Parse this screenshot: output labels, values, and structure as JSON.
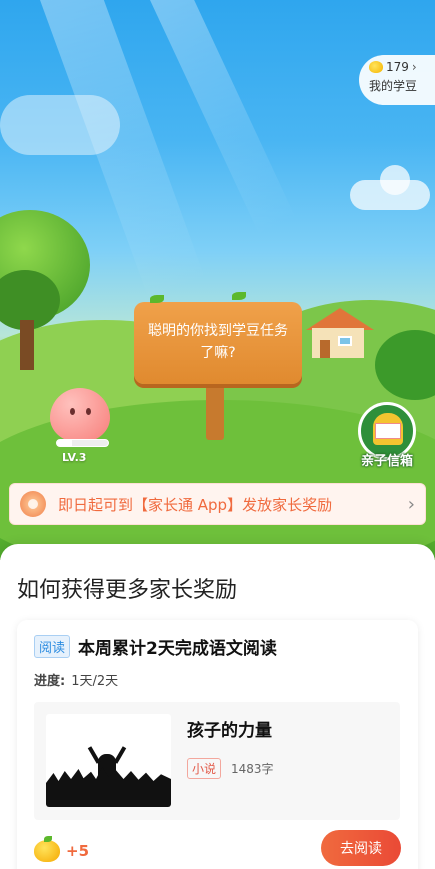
{
  "colors": {
    "accent": "#f06a3e",
    "sky": "#49b5f3",
    "grass": "#6cc23c",
    "read_tag": "#2c8ce0"
  },
  "coins": {
    "count": "179",
    "label": "我的学豆",
    "icon": "bean-coin-icon"
  },
  "sign": {
    "text": "聪明的你找到学豆任务了嘛?"
  },
  "pet": {
    "level_label": "LV.3",
    "level_progress": 0.3,
    "icon": "heart-pet-icon"
  },
  "mailbox": {
    "label": "亲子信箱",
    "icon": "mailbox-icon"
  },
  "banner": {
    "text": "即日起可到【家长通 App】发放家长奖励",
    "icon": "gift-icon"
  },
  "sheet": {
    "title": "如何获得更多家长奖励",
    "task": {
      "tag": "阅读",
      "title": "本周累计2天完成语文阅读",
      "progress_label": "进度:",
      "progress_value": "1天/2天",
      "book": {
        "title": "孩子的力量",
        "genre": "小说",
        "word_count": "1483字"
      },
      "reward": "+5",
      "button": "去阅读"
    }
  }
}
